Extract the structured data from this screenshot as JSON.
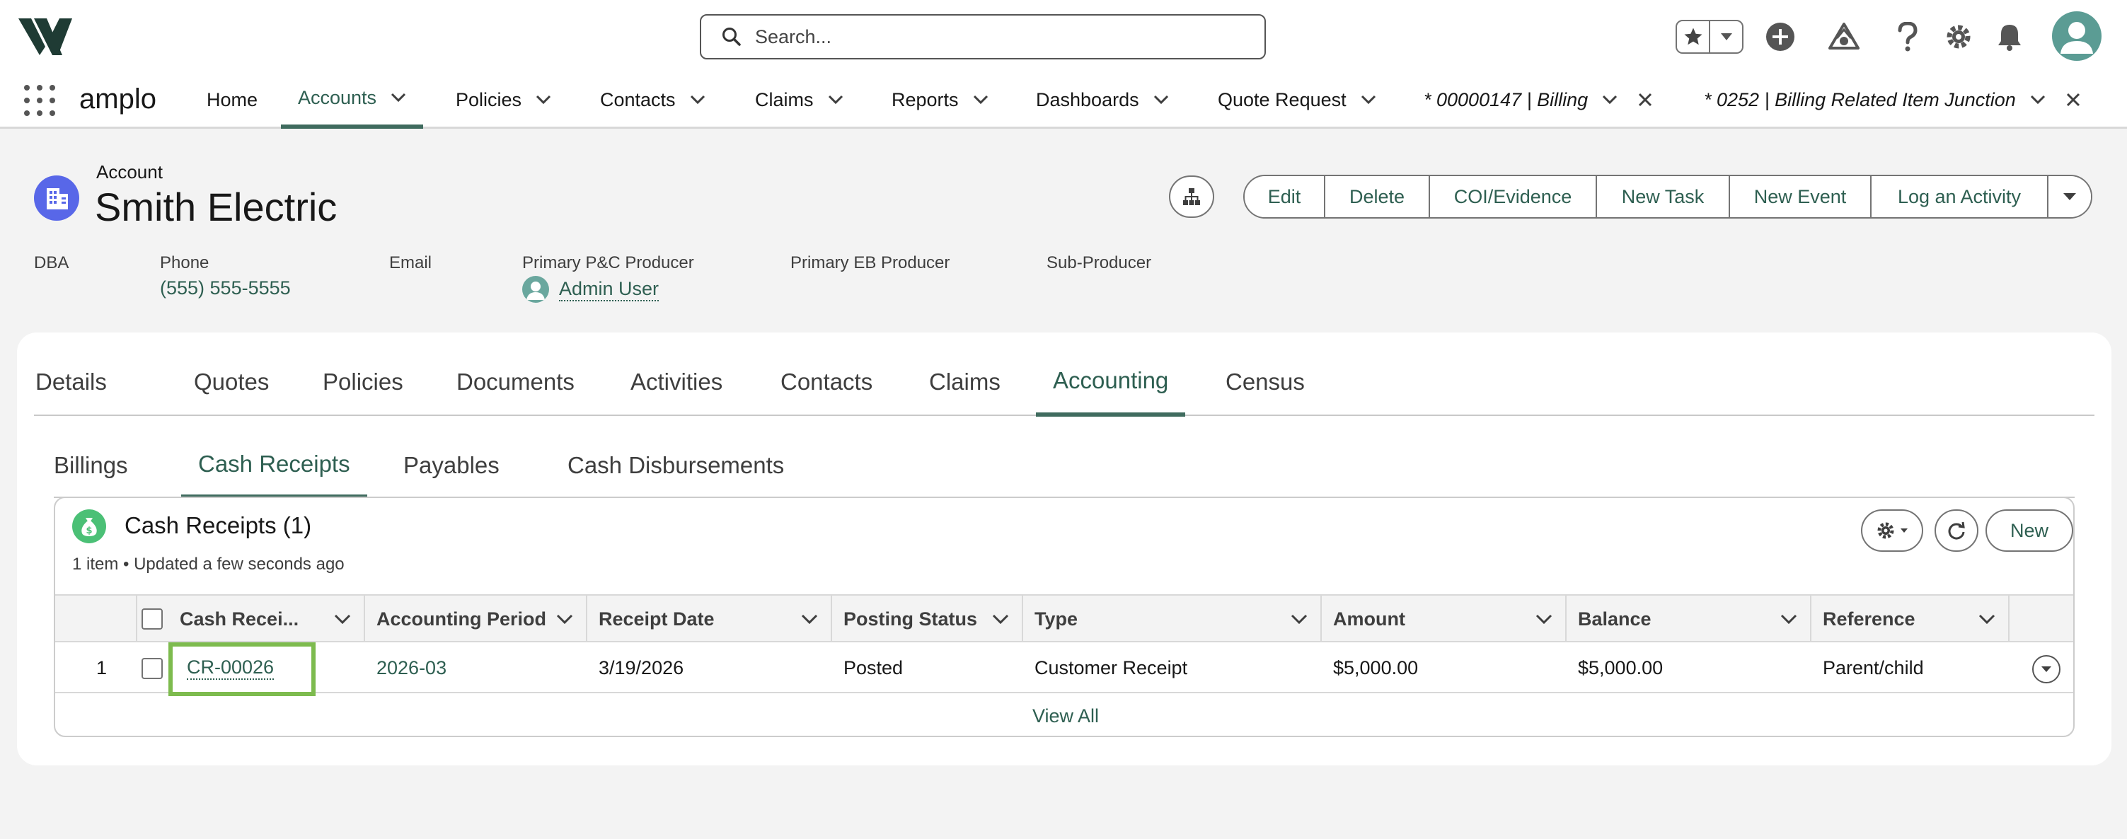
{
  "global_header": {
    "search_placeholder": "Search..."
  },
  "app_nav": {
    "app_name": "amplo",
    "items": [
      {
        "label": "Home"
      },
      {
        "label": "Accounts"
      },
      {
        "label": "Policies"
      },
      {
        "label": "Contacts"
      },
      {
        "label": "Claims"
      },
      {
        "label": "Reports"
      },
      {
        "label": "Dashboards"
      },
      {
        "label": "Quote Request"
      },
      {
        "label": "* 00000147 | Billing"
      },
      {
        "label": "* 0252 | Billing Related Item Junction"
      }
    ]
  },
  "record": {
    "object_label": "Account",
    "name": "Smith Electric",
    "actions": [
      "Edit",
      "Delete",
      "COI/Evidence",
      "New Task",
      "New Event",
      "Log an Activity"
    ],
    "highlights": {
      "dba_label": "DBA",
      "phone_label": "Phone",
      "phone_value": "(555) 555-5555",
      "email_label": "Email",
      "pc_producer_label": "Primary P&C Producer",
      "pc_producer_value": "Admin User",
      "eb_producer_label": "Primary EB Producer",
      "sub_producer_label": "Sub-Producer"
    }
  },
  "tabs": [
    "Details",
    "Quotes",
    "Policies",
    "Documents",
    "Activities",
    "Contacts",
    "Claims",
    "Accounting",
    "Census"
  ],
  "subtabs": [
    "Billings",
    "Cash Receipts",
    "Payables",
    "Cash Disbursements"
  ],
  "related_list": {
    "title": "Cash Receipts (1)",
    "subtitle": "1 item • Updated a few seconds ago",
    "new_label": "New",
    "columns": [
      "Cash Recei...",
      "Accounting Period",
      "Receipt Date",
      "Posting Status",
      "Type",
      "Amount",
      "Balance",
      "Reference"
    ],
    "rows": [
      {
        "index": "1",
        "name": "CR-00026",
        "period": "2026-03",
        "date": "3/19/2026",
        "status": "Posted",
        "type": "Customer Receipt",
        "amount": "$5,000.00",
        "balance": "$5,000.00",
        "reference": "Parent/child"
      }
    ],
    "view_all": "View All"
  },
  "colors": {
    "accent": "#2e5f51",
    "account_icon": "#5867e8",
    "cash_icon": "#4bc076",
    "focus": "#7dbb4e"
  }
}
